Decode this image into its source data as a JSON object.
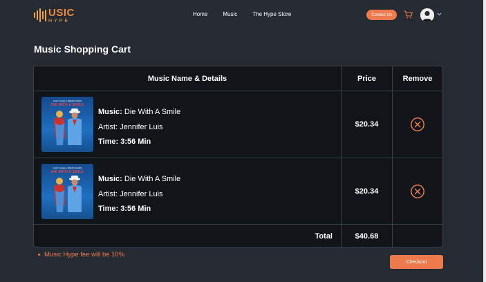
{
  "brand": {
    "logo_main": "USIC",
    "logo_sub": "HYPE"
  },
  "nav": {
    "links": [
      "Home",
      "Music",
      "The Hype Store"
    ],
    "contact_label": "Contact Us"
  },
  "page": {
    "title": "Music Shopping Cart"
  },
  "table": {
    "headers": {
      "name": "Music Name & Details",
      "price": "Price",
      "remove": "Remove"
    },
    "items": [
      {
        "cover_top": "LADY GAGA & BRUNO MARS",
        "cover_title": "DIE WITH A SMILE",
        "music_label": "Music:",
        "music_value": "Die With A Smile",
        "artist_label": "Artist:",
        "artist_value": "Jennifer Luis",
        "time_label": "Time:",
        "time_value": "3:56 Min",
        "price": "$20.34"
      },
      {
        "cover_top": "LADY GAGA & BRUNO MARS",
        "cover_title": "DIE WITH A SMILE",
        "music_label": "Music:",
        "music_value": "Die With A Smile",
        "artist_label": "Artist:",
        "artist_value": "Jennifer Luis",
        "time_label": "Time:",
        "time_value": "3:56 Min",
        "price": "$20.34"
      }
    ],
    "total_label": "Total",
    "total_value": "$40.68"
  },
  "footer": {
    "fee_note": "Music Hype fee will be 10%",
    "checkout_label": "Checkout"
  },
  "icons": {
    "cart": "cart-icon",
    "remove": "close-circle-icon",
    "chevron": "chevron-down-icon",
    "logo": "sound-bars-icon"
  },
  "colors": {
    "background": "#252a33",
    "table_background": "#111419",
    "accent": "#ee7b4d",
    "logo_bars": "#f5a431"
  }
}
